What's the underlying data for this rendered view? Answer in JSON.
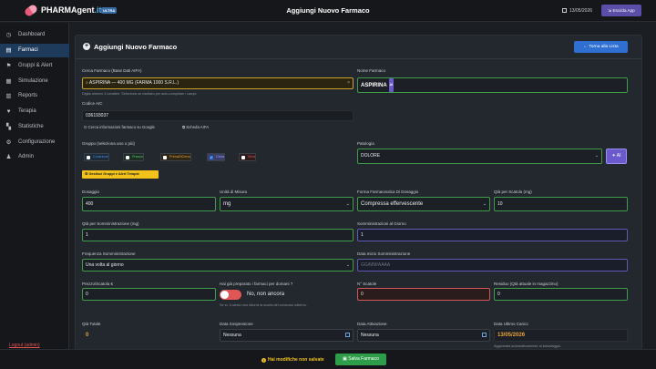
{
  "topbar": {
    "brand_main": "PHARMAgent",
    "brand_suffix": ".it",
    "badge": "ULTRA",
    "title": "Aggiungi Nuovo Farmaco",
    "date": "13/05/2026",
    "exit_label": "Esci/da App"
  },
  "sidebar": {
    "items": [
      {
        "label": "Dashboard",
        "icon": "dashboard-icon",
        "glyph": "◷"
      },
      {
        "label": "Farmaci",
        "icon": "pill-icon",
        "glyph": "▤"
      },
      {
        "label": "Gruppi & Alert",
        "icon": "group-icon",
        "glyph": "⚑"
      },
      {
        "label": "Simulazione",
        "icon": "simulation-icon",
        "glyph": "▦"
      },
      {
        "label": "Reports",
        "icon": "reports-icon",
        "glyph": "▥"
      },
      {
        "label": "Terapia",
        "icon": "therapy-icon",
        "glyph": "♥"
      },
      {
        "label": "Statistiche",
        "icon": "stats-icon",
        "glyph": "▚"
      },
      {
        "label": "Configurazione",
        "icon": "gear-icon",
        "glyph": "⚙"
      },
      {
        "label": "Admin",
        "icon": "admin-icon",
        "glyph": "♟"
      }
    ],
    "active_index": 1,
    "logout": "Logout (admin)"
  },
  "card": {
    "title": "Aggiungi Nuovo Farmaco",
    "back_label": "← Torna alla Lista"
  },
  "form": {
    "cerca_label": "Cerca Farmaco (Base Dati AIFA)",
    "cerca_value": "ASPIRINA — 400 MG (FARMA 1000 S.R.L.)",
    "cerca_hint": "Digita almeno 3 caratteri. Seleziona un risultato per auto-compilare i campi.",
    "nome_label": "Nome Farmaco",
    "nome_value": "ASPIRINA",
    "ai_tag": "AI",
    "codice_label": "Codice AIC",
    "codice_value": "036193037",
    "google_label": "Cerca informazioni farmaco su Google",
    "aifa_label": "Scheda AIFA",
    "gruppo_label": "Gruppo (seleziona uno o più)",
    "gruppi": [
      {
        "label": "Colazione",
        "checked": false,
        "color": "#4a90d9",
        "bg": "#1c2a3a"
      },
      {
        "label": "Pranzo",
        "checked": false,
        "color": "#5ec07a",
        "bg": "#1c2e22"
      },
      {
        "label": "PrimaDiCena",
        "checked": false,
        "color": "#e8a23a",
        "bg": "#2e2718"
      },
      {
        "label": "Cena",
        "checked": true,
        "color": "#9aa7ff",
        "bg": "#3a3f6a"
      },
      {
        "label": "Sera",
        "checked": false,
        "color": "#e05656",
        "bg": "#2e1c1c"
      }
    ],
    "gestisci_label": "Gestisci Gruppi e Alert Terapie",
    "patologia_label": "Patologia",
    "patologia_value": "DOLORE",
    "ai_button": "AI",
    "dosaggio_label": "Dosaggio",
    "dosaggio_value": "400",
    "unita_label": "Unità di Misura",
    "unita_value": "mg",
    "forma_label": "Forma Farmaceutica Di Dosaggio",
    "forma_value": "Compressa effervescente",
    "qta_scatola_label": "Qtà per Scatola (mg)",
    "qta_scatola_value": "10",
    "qta_somm_label": "Qtà per Somministrazione (mg)",
    "qta_somm_value": "1",
    "somm_giorno_label": "Somministrazioni al Giorno",
    "somm_giorno_value": "1",
    "frequenza_label": "Frequenza Somministrazione",
    "frequenza_value": "Una volta al giorno",
    "data_inizio_label": "Data Inizio Somministrazione",
    "data_inizio_placeholder": "GG/MM/AAAA",
    "prezzo_label": "Prezzo/Scatola €",
    "prezzo_value": "0",
    "preparato_label": "Hai già preparato i farmaci per domani ?",
    "preparato_value": "No, non ancora",
    "preparato_hint": "Se sì, il carico non ridurrà la scorta del consumo odierno.",
    "scatole_label": "N° Scatole",
    "scatole_value": "0",
    "residuo_label": "Residuo (Qtà attuale in magazzino)",
    "residuo_value": "0",
    "qta_totale_label": "Qtà Totale",
    "qta_totale_value": "0",
    "data_sosp_label": "Data Sospensione",
    "data_sosp_value": "Nessuna",
    "data_att_label": "Data Attivazione",
    "data_att_value": "Nessuna",
    "data_ultimo_label": "Data Ultimo Carico",
    "data_ultimo_value": "13/05/2026",
    "data_ultimo_hint": "Aggiornata automaticamente al salvataggio."
  },
  "bottombar": {
    "unsaved": "Hai modifiche non salvate",
    "save_label": "Salva Farmaco"
  },
  "colors": {
    "accent": "#2f6fd1",
    "success": "#2e9d4a",
    "warning": "#f3c21a",
    "danger": "#e05656",
    "ai": "#6a5acd"
  }
}
